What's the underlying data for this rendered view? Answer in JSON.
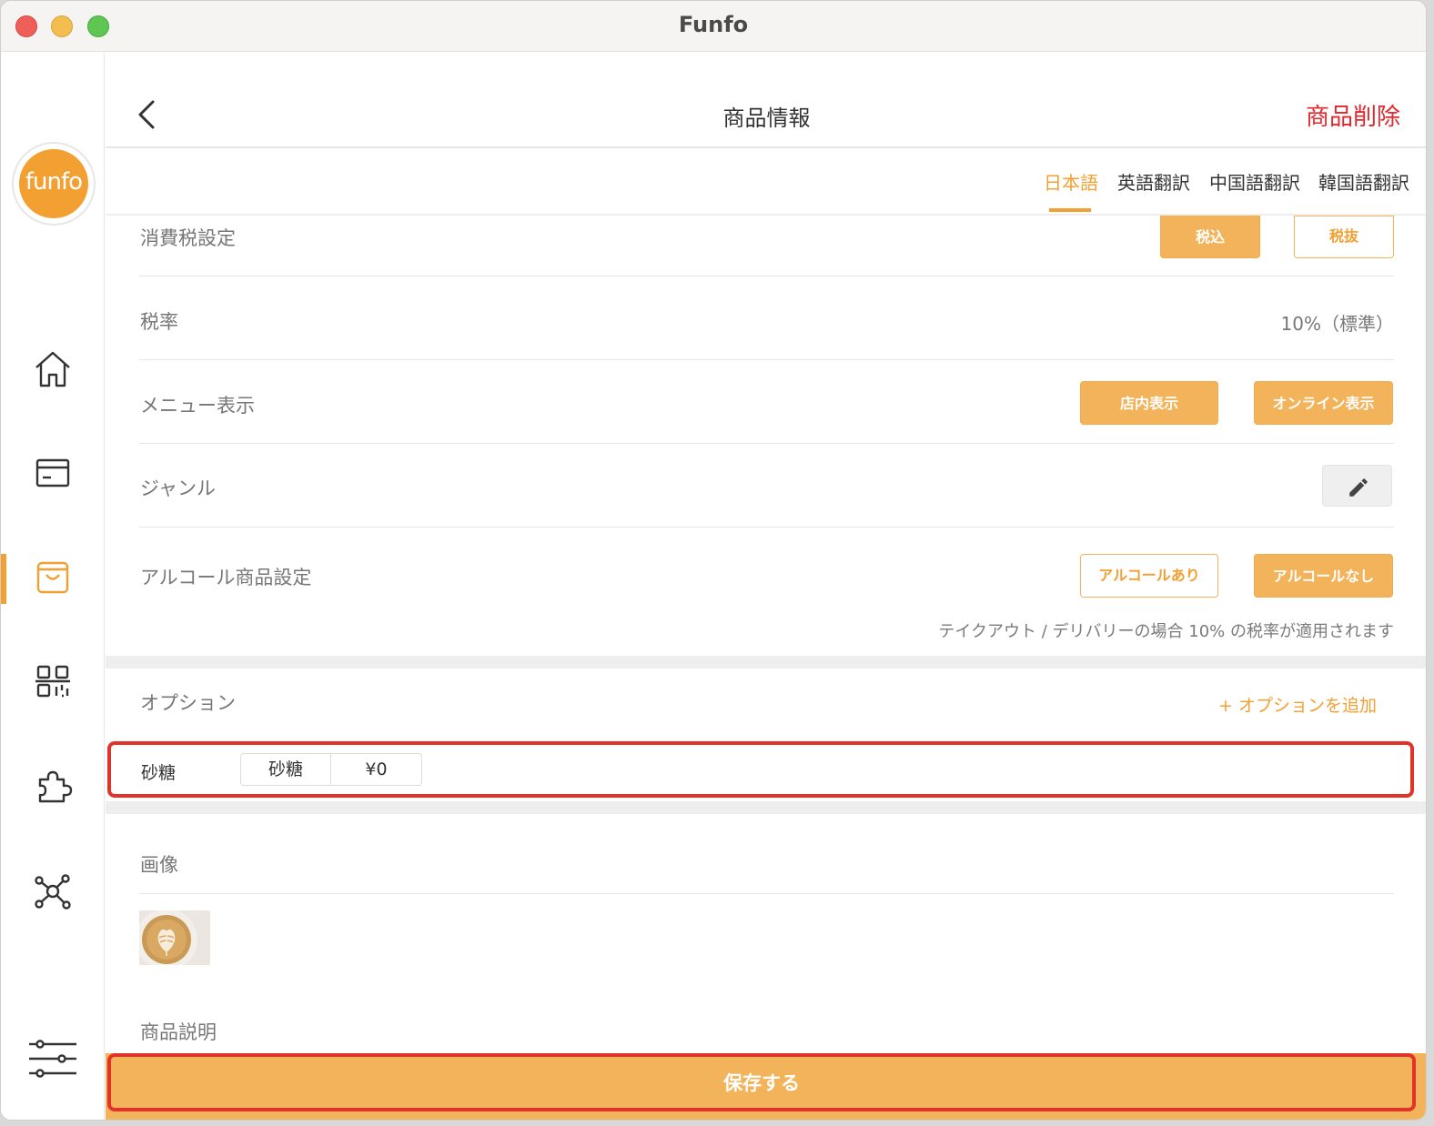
{
  "window": {
    "title": "Funfo"
  },
  "sidebar": {
    "logo_text": "funfo",
    "items": [
      {
        "icon": "home-icon"
      },
      {
        "icon": "card-icon"
      },
      {
        "icon": "shopping-bag-icon",
        "active": true
      },
      {
        "icon": "qr-code-icon"
      },
      {
        "icon": "puzzle-icon"
      },
      {
        "icon": "network-icon"
      },
      {
        "icon": "sliders-icon"
      }
    ],
    "accent_color": "#f3a033"
  },
  "header": {
    "title": "商品情報",
    "delete_label": "商品削除"
  },
  "tabs": [
    {
      "label": "日本語",
      "active": true
    },
    {
      "label": "英語翻訳"
    },
    {
      "label": "中国語翻訳"
    },
    {
      "label": "韓国語翻訳"
    }
  ],
  "form": {
    "tax_setting": {
      "label": "消費税設定",
      "options": [
        "税込",
        "税抜"
      ],
      "selected": "税込"
    },
    "tax_rate": {
      "label": "税率",
      "value": "10%（標準）"
    },
    "menu_display": {
      "label": "メニュー表示",
      "options": [
        "店内表示",
        "オンライン表示"
      ]
    },
    "genre": {
      "label": "ジャンル"
    },
    "alcohol": {
      "label": "アルコール商品設定",
      "options": [
        "アルコールあり",
        "アルコールなし"
      ],
      "selected": "アルコールなし"
    },
    "note": "テイクアウト / デリバリーの場合 10% の税率が適用されます"
  },
  "options_section": {
    "label": "オプション",
    "add_label": "+ オプションを追加",
    "items": [
      {
        "name": "砂糖",
        "choice": "砂糖",
        "price": "¥0"
      }
    ]
  },
  "image_section": {
    "label": "画像"
  },
  "description_section": {
    "label": "商品説明"
  },
  "save_label": "保存する",
  "colors": {
    "accent": "#f3a033",
    "button": "#f3b35a",
    "danger": "#e4272c",
    "highlight": "#e2332a"
  }
}
